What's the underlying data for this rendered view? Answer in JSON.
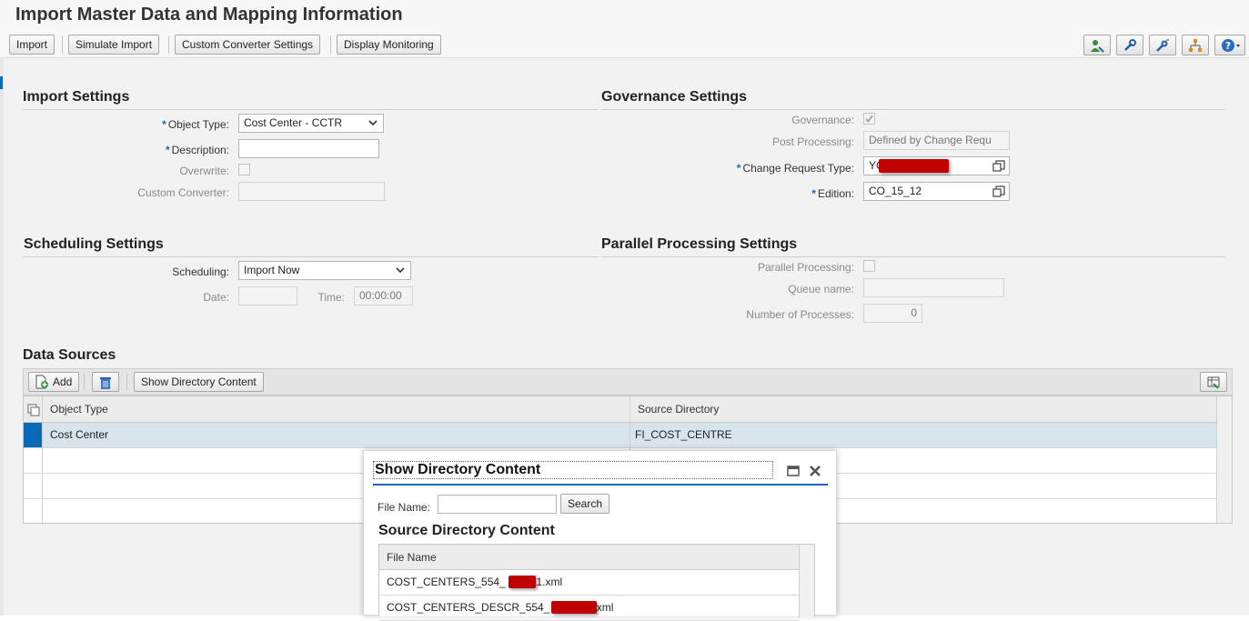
{
  "header": {
    "title": "Import Master Data and Mapping Information",
    "buttons": {
      "import": "Import",
      "simulate": "Simulate Import",
      "custom_converter": "Custom Converter Settings",
      "display_monitoring": "Display Monitoring"
    },
    "icons": [
      "user-settings-icon",
      "wrench-icon",
      "wrench-pen-icon",
      "hierarchy-icon",
      "help-icon"
    ]
  },
  "import_settings": {
    "title": "Import Settings",
    "object_type_label": "Object Type:",
    "object_type_value": "Cost Center - CCTR",
    "description_label": "Description:",
    "description_value": "",
    "overwrite_label": "Overwrite:",
    "custom_converter_label": "Custom Converter:",
    "custom_converter_value": ""
  },
  "governance_settings": {
    "title": "Governance Settings",
    "governance_label": "Governance:",
    "governance_checked": true,
    "post_processing_label": "Post Processing:",
    "post_processing_value": "Defined by Change Requ",
    "change_request_type_label": "Change Request Type:",
    "change_request_type_value": "YC",
    "edition_label": "Edition:",
    "edition_value": "CO_15_12"
  },
  "scheduling_settings": {
    "title": "Scheduling Settings",
    "scheduling_label": "Scheduling:",
    "scheduling_value": "Import Now",
    "date_label": "Date:",
    "date_value": "",
    "time_label": "Time:",
    "time_value": "00:00:00"
  },
  "parallel_settings": {
    "title": "Parallel Processing Settings",
    "parallel_label": "Parallel Processing:",
    "queue_label": "Queue name:",
    "queue_value": "",
    "processes_label": "Number of Processes:",
    "processes_value": "0"
  },
  "data_sources": {
    "title": "Data Sources",
    "add_label": "Add",
    "show_dir_label": "Show Directory Content",
    "columns": [
      "Object Type",
      "Source Directory"
    ],
    "rows": [
      {
        "object_type": "Cost Center",
        "source_directory": "FI_COST_CENTRE"
      }
    ]
  },
  "dialog": {
    "title": "Show Directory Content",
    "file_name_label": "File Name:",
    "file_name_value": "",
    "search_label": "Search",
    "subtitle": "Source Directory Content",
    "column": "File Name",
    "files": [
      {
        "prefix": "COST_CENTERS_554_",
        "suffix": "11.xml"
      },
      {
        "prefix": "COST_CENTERS_DESCR_554_",
        "suffix": ".xml"
      }
    ]
  },
  "colors": {
    "accent": "#1a6ac0",
    "redaction": "#c00000",
    "selected_row": "#d7e4ec"
  }
}
